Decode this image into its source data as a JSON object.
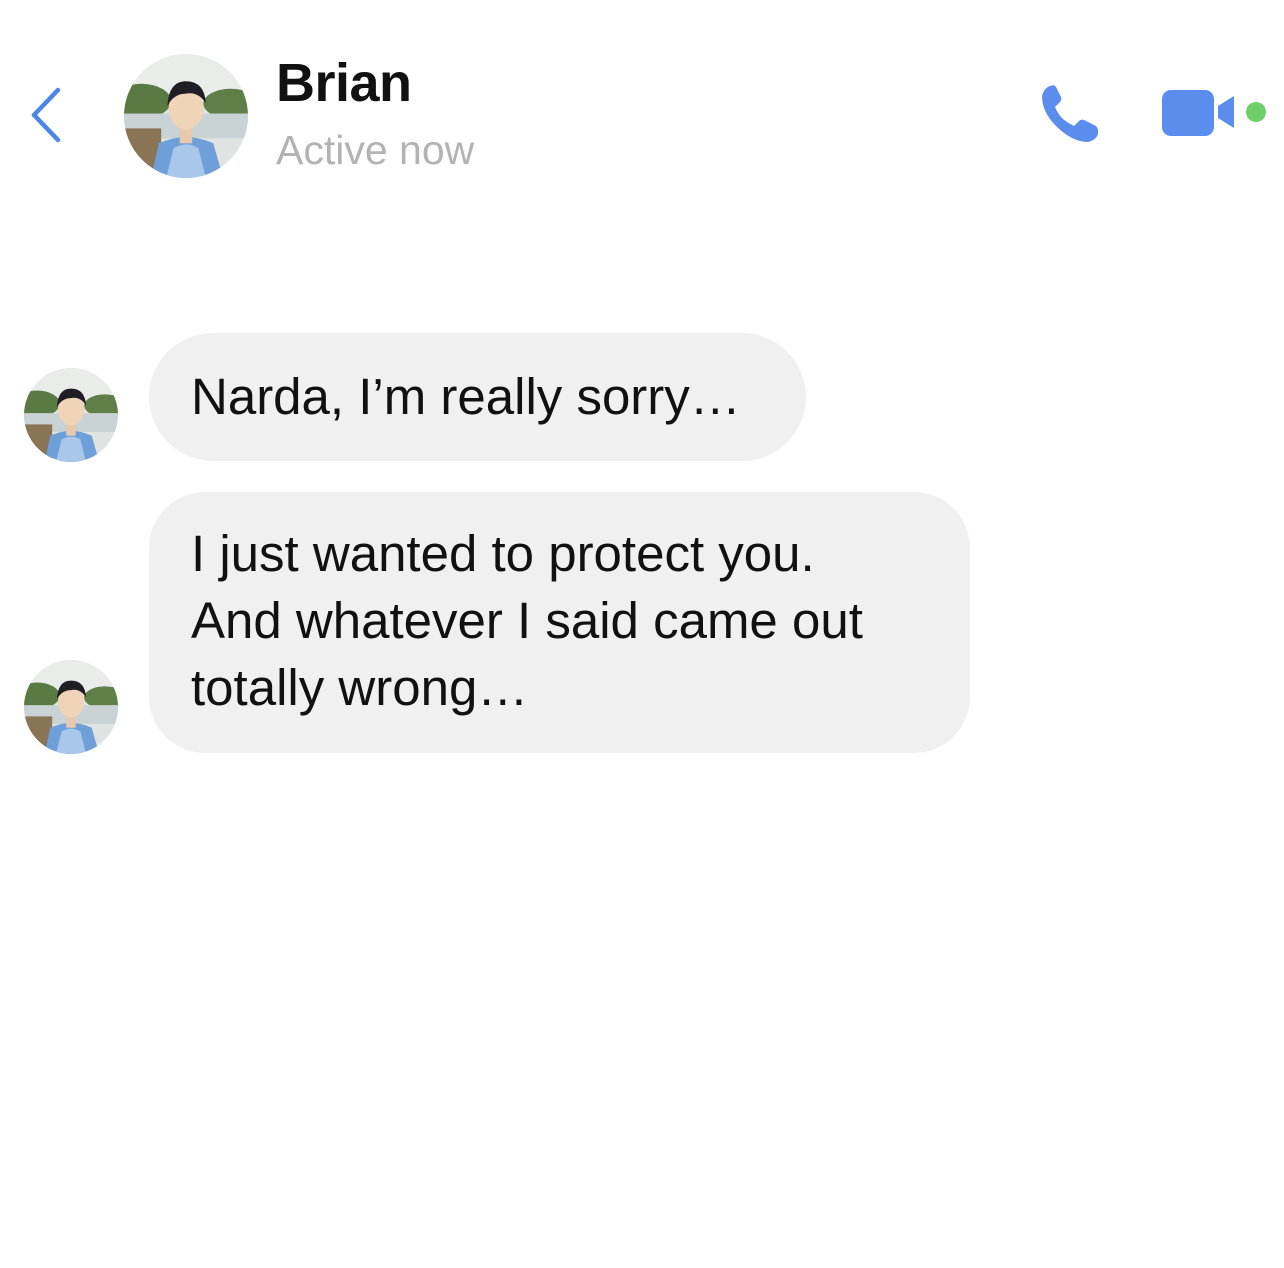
{
  "header": {
    "name": "Brian",
    "status": "Active now",
    "back_icon": "chevron-left-icon",
    "call_icon": "phone-icon",
    "video_icon": "video-camera-icon",
    "accent_color": "#5b8def",
    "active_color": "#6fcf6a"
  },
  "messages": [
    {
      "sender": "Brian",
      "lines": [
        "Narda, I’m really sorry…"
      ]
    },
    {
      "sender": "Brian",
      "lines": [
        "I just wanted to protect you.",
        "And whatever I said came out",
        "totally wrong…"
      ]
    }
  ]
}
